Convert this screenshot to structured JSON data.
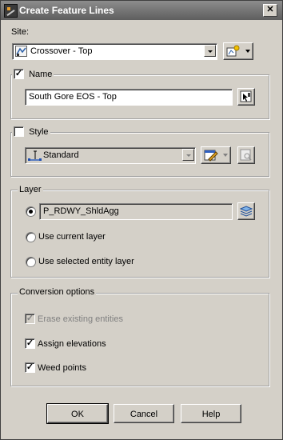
{
  "window": {
    "title": "Create Feature Lines"
  },
  "site": {
    "label": "Site:",
    "value": "Crossover - Top"
  },
  "name": {
    "label": "Name",
    "checked": true,
    "value": "South Gore EOS - Top"
  },
  "style": {
    "label": "Style",
    "checked": false,
    "value": "Standard"
  },
  "layer": {
    "label": "Layer",
    "value": "P_RDWY_ShldAgg",
    "options": [
      {
        "label": "",
        "selected": true
      },
      {
        "label": "Use current layer",
        "selected": false
      },
      {
        "label": "Use selected entity layer",
        "selected": false
      }
    ]
  },
  "conversion": {
    "label": "Conversion options",
    "erase": {
      "label": "Erase existing entities",
      "checked": true,
      "enabled": false
    },
    "assign": {
      "label": "Assign elevations",
      "checked": true
    },
    "weed": {
      "label": "Weed points",
      "checked": true
    }
  },
  "footer": {
    "ok": "OK",
    "cancel": "Cancel",
    "help": "Help"
  }
}
